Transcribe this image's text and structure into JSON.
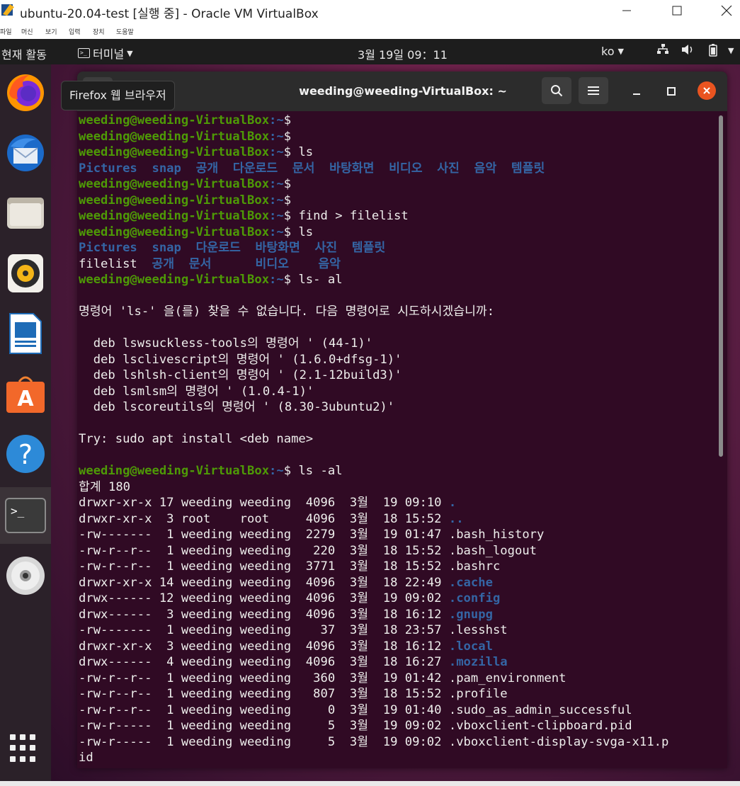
{
  "vbox": {
    "title": "ubuntu-20.04-test [실행 중] - Oracle VM VirtualBox",
    "menus": [
      "파일",
      "머신",
      "보기",
      "입력",
      "장치",
      "도움말"
    ]
  },
  "topbar": {
    "activities": "현재 활동",
    "app_menu": "터미널",
    "clock": "3월 19일 09：11",
    "lang": "ko"
  },
  "dock": {
    "tooltip": "Firefox 웹 브라우저",
    "items": [
      "firefox",
      "thunderbird",
      "files",
      "rhythmbox",
      "libreoffice-writer",
      "software-center",
      "help",
      "terminal",
      "dvd"
    ]
  },
  "terminal": {
    "title": "weeding@weeding-VirtualBox: ~",
    "prompt_user": "weeding@weeding-VirtualBox",
    "prompt_path": ":~$",
    "lines": [
      {
        "t": "p",
        "c": ""
      },
      {
        "t": "p",
        "c": ""
      },
      {
        "t": "p",
        "c": " ls"
      },
      {
        "t": "b",
        "c": "Pictures  snap  공개  다운로드  문서  바탕화면  비디오  사진  음악  템플릿"
      },
      {
        "t": "p",
        "c": ""
      },
      {
        "t": "p",
        "c": ""
      },
      {
        "t": "p",
        "c": " find > filelist"
      },
      {
        "t": "p",
        "c": " ls"
      },
      {
        "t": "b",
        "c": "Pictures  snap  다운로드  바탕화면  사진  템플릿"
      },
      {
        "t": "m",
        "a": "filelist  ",
        "b": "공개  문서      비디오    음악"
      },
      {
        "t": "p",
        "c": " ls- al"
      },
      {
        "t": "n",
        "c": ""
      },
      {
        "t": "n",
        "c": "명령어 'ls-' 을(를) 찾을 수 없습니다. 다음 명령어로 시도하시겠습니까:"
      },
      {
        "t": "n",
        "c": ""
      },
      {
        "t": "n",
        "c": "  deb lswsuckless-tools의 명령어 ' (44-1)'"
      },
      {
        "t": "n",
        "c": "  deb lsclivescript의 명령어 ' (1.6.0+dfsg-1)'"
      },
      {
        "t": "n",
        "c": "  deb lshlsh-client의 명령어 ' (2.1-12build3)'"
      },
      {
        "t": "n",
        "c": "  deb lsmlsm의 명령어 ' (1.0.4-1)'"
      },
      {
        "t": "n",
        "c": "  deb lscoreutils의 명령어 ' (8.30-3ubuntu2)'"
      },
      {
        "t": "n",
        "c": ""
      },
      {
        "t": "n",
        "c": "Try: sudo apt install <deb name>"
      },
      {
        "t": "n",
        "c": ""
      },
      {
        "t": "p",
        "c": " ls -al"
      },
      {
        "t": "n",
        "c": "합계 180"
      },
      {
        "t": "f",
        "c": "drwxr-xr-x 17 weeding weeding  4096  3월  19 09:10 ",
        "f": ".",
        "d": true
      },
      {
        "t": "f",
        "c": "drwxr-xr-x  3 root    root     4096  3월  18 15:52 ",
        "f": "..",
        "d": true
      },
      {
        "t": "f",
        "c": "-rw-------  1 weeding weeding  2279  3월  19 01:47 ",
        "f": ".bash_history",
        "d": false
      },
      {
        "t": "f",
        "c": "-rw-r--r--  1 weeding weeding   220  3월  18 15:52 ",
        "f": ".bash_logout",
        "d": false
      },
      {
        "t": "f",
        "c": "-rw-r--r--  1 weeding weeding  3771  3월  18 15:52 ",
        "f": ".bashrc",
        "d": false
      },
      {
        "t": "f",
        "c": "drwxr-xr-x 14 weeding weeding  4096  3월  18 22:49 ",
        "f": ".cache",
        "d": true
      },
      {
        "t": "f",
        "c": "drwx------ 12 weeding weeding  4096  3월  19 09:02 ",
        "f": ".config",
        "d": true
      },
      {
        "t": "f",
        "c": "drwx------  3 weeding weeding  4096  3월  18 16:12 ",
        "f": ".gnupg",
        "d": true
      },
      {
        "t": "f",
        "c": "-rw-------  1 weeding weeding    37  3월  18 23:57 ",
        "f": ".lesshst",
        "d": false
      },
      {
        "t": "f",
        "c": "drwxr-xr-x  3 weeding weeding  4096  3월  18 16:12 ",
        "f": ".local",
        "d": true
      },
      {
        "t": "f",
        "c": "drwx------  4 weeding weeding  4096  3월  18 16:27 ",
        "f": ".mozilla",
        "d": true
      },
      {
        "t": "f",
        "c": "-rw-r--r--  1 weeding weeding   360  3월  19 01:42 ",
        "f": ".pam_environment",
        "d": false
      },
      {
        "t": "f",
        "c": "-rw-r--r--  1 weeding weeding   807  3월  18 15:52 ",
        "f": ".profile",
        "d": false
      },
      {
        "t": "f",
        "c": "-rw-r--r--  1 weeding weeding     0  3월  19 01:40 ",
        "f": ".sudo_as_admin_successful",
        "d": false
      },
      {
        "t": "f",
        "c": "-rw-r-----  1 weeding weeding     5  3월  19 09:02 ",
        "f": ".vboxclient-clipboard.pid",
        "d": false
      },
      {
        "t": "f",
        "c": "-rw-r-----  1 weeding weeding     5  3월  19 09:02 ",
        "f": ".vboxclient-display-svga-x11.p",
        "d": false
      },
      {
        "t": "n",
        "c": "id"
      }
    ]
  },
  "colors": {
    "terminal_bg": "#300a24",
    "prompt_green": "#4e9a06",
    "dir_blue": "#3465a4",
    "ubuntu_orange": "#e95420"
  }
}
